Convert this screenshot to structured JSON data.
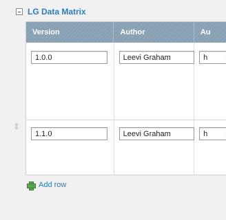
{
  "field": {
    "title": "LG Data Matrix"
  },
  "columns": [
    "Version",
    "Author",
    "Au"
  ],
  "rows": [
    [
      "1.0.0",
      "Leevi Graham",
      "h"
    ],
    [
      "1.1.0",
      "Leevi Graham",
      "h"
    ]
  ],
  "actions": {
    "add_row": "Add row"
  },
  "icons": {
    "toggle": "collapse-icon",
    "drag": "drag-handle-icon",
    "add": "plus-icon"
  },
  "colors": {
    "accent": "#2a7cc7",
    "header": "#869fb3",
    "add": "#57a84a"
  }
}
